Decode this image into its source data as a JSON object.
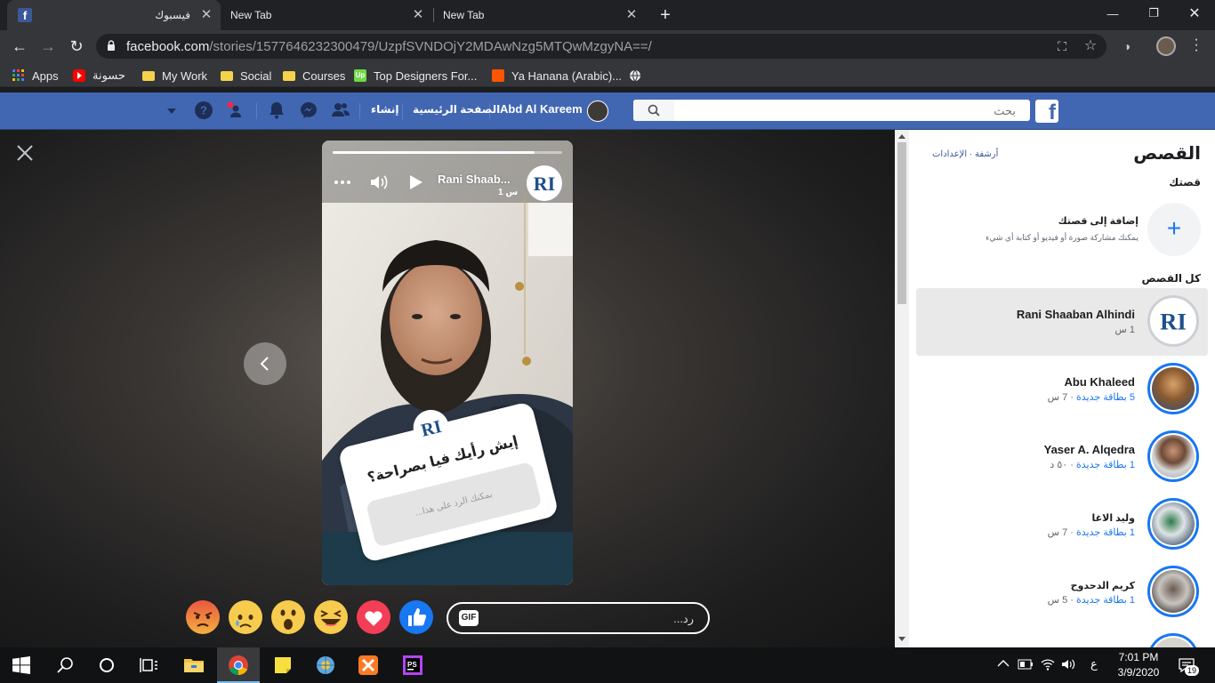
{
  "browser": {
    "tabs": [
      {
        "title": "فيسبوك",
        "active": true
      },
      {
        "title": "New Tab",
        "active": false
      },
      {
        "title": "New Tab",
        "active": false
      }
    ],
    "url_host": "facebook.com",
    "url_path": "/stories/1577646232300479/UzpfSVNDOjY2MDAwNzg5MTQwMzgyNA==/",
    "bookmarks": [
      {
        "label": "Apps",
        "icon": "apps-grid-icon"
      },
      {
        "label": "حسونة",
        "icon": "youtube-icon"
      },
      {
        "label": "My Work",
        "icon": "folder-icon"
      },
      {
        "label": "Social",
        "icon": "folder-icon"
      },
      {
        "label": "Courses",
        "icon": "folder-icon"
      },
      {
        "label": "Top Designers For...",
        "icon": "upwork-icon"
      },
      {
        "label": "Ya Hanana (Arabic)...",
        "icon": "soundcloud-icon"
      },
      {
        "label": "",
        "icon": "globe-icon"
      }
    ]
  },
  "fb_header": {
    "search_placeholder": "بحث",
    "profile_name": "Abd Al Kareem",
    "home_label": "الصفحة الرئيسية",
    "create_label": "إنشاء",
    "brand_color": "#4267b2"
  },
  "story": {
    "owner": "Rani Shaab...",
    "time": "1 س",
    "progress": 0.88,
    "question": "إيش رأيك فيا بصراحة؟",
    "reply_hint": "بمكنك الرد على هذا...",
    "reply_placeholder": "رد...",
    "gif_label": "GIF",
    "reactions": [
      "angry-reaction-icon",
      "sad-reaction-icon",
      "wow-reaction-icon",
      "haha-reaction-icon",
      "love-reaction-icon",
      "like-reaction-icon"
    ]
  },
  "sidebar": {
    "title": "القصص",
    "links": "أرشفة · الإعدادات",
    "your_story": "قصتك",
    "add_title": "إضافة إلى قصتك",
    "add_desc": "يمكنك مشاركة صورة أو فيديو أو كتابة أي شيء",
    "all_stories": "كل القصص",
    "stories": [
      {
        "name": "Rani Shaaban Alhindi",
        "new_count": "",
        "time": "1 س",
        "selected": true,
        "seen": true
      },
      {
        "name": "Abu Khaleed",
        "new_count": "5 بطاقة جديدة",
        "time": "7 س",
        "selected": false,
        "seen": false
      },
      {
        "name": "Yaser A. Alqedra",
        "new_count": "1 بطاقة جديدة",
        "time": "٥٠ د",
        "selected": false,
        "seen": false
      },
      {
        "name": "وليد الاغا",
        "new_count": "1 بطاقة جديدة",
        "time": "7 س",
        "selected": false,
        "seen": false
      },
      {
        "name": "كريم الدحدوح",
        "new_count": "1 بطاقة جديدة",
        "time": "5 س",
        "selected": false,
        "seen": false
      }
    ]
  },
  "taskbar": {
    "time": "7:01 PM",
    "date": "3/9/2020",
    "lang": "ع",
    "notifications": "19"
  }
}
